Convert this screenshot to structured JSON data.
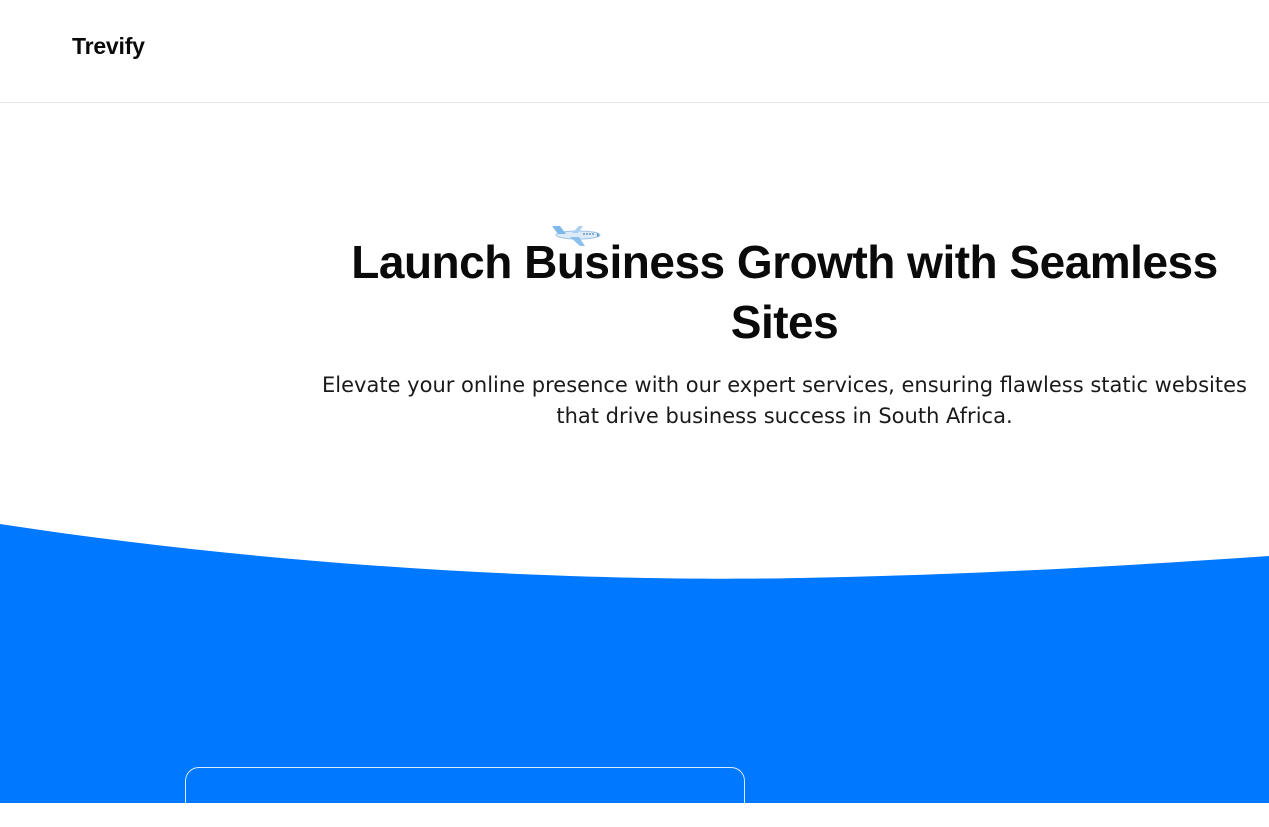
{
  "brand": {
    "logo_text": "Trevify"
  },
  "hero": {
    "title": "Launch Business Growth with Seamless Sites",
    "subtitle": "Elevate your online presence with our expert services, ensuring flawless static websites that drive business success in South Africa.",
    "decoration_icon": "airplane-icon"
  },
  "colors": {
    "accent": "#0078ff",
    "background": "#ffffff",
    "text": "#0a0a0a",
    "header_border": "#e8e8e8"
  }
}
